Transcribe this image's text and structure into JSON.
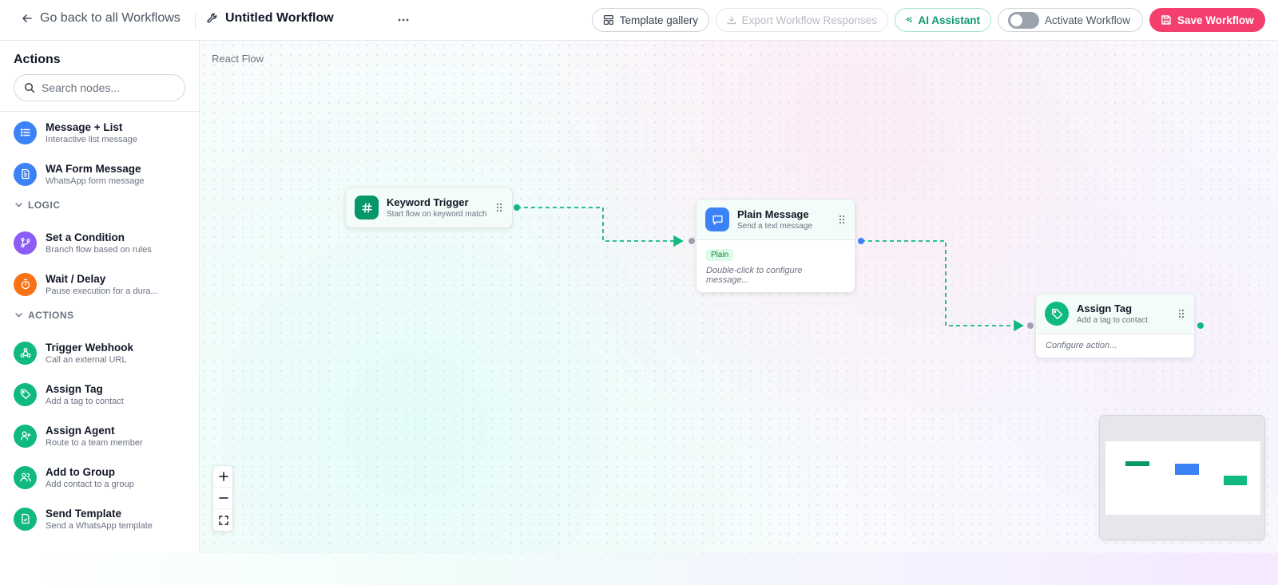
{
  "header": {
    "back_label": "Go back to all Workflows",
    "title": "Untitled Workflow",
    "buttons": {
      "template_gallery": "Template gallery",
      "export": "Export Workflow Responses",
      "ai_assistant": "AI Assistant",
      "activate": "Activate Workflow",
      "save": "Save Workflow"
    }
  },
  "sidebar": {
    "title": "Actions",
    "search_placeholder": "Search nodes...",
    "items_top": [
      {
        "name": "Message + List",
        "desc": "Interactive list message",
        "icon": "list-icon"
      },
      {
        "name": "WA Form Message",
        "desc": "WhatsApp form message",
        "icon": "form-icon"
      }
    ],
    "sections": [
      {
        "label": "LOGIC",
        "items": [
          {
            "name": "Set a Condition",
            "desc": "Branch flow based on rules",
            "icon": "branch-icon"
          },
          {
            "name": "Wait / Delay",
            "desc": "Pause execution for a dura...",
            "icon": "timer-icon"
          }
        ]
      },
      {
        "label": "ACTIONS",
        "items": [
          {
            "name": "Trigger Webhook",
            "desc": "Call an external URL",
            "icon": "webhook-icon"
          },
          {
            "name": "Assign Tag",
            "desc": "Add a tag to contact",
            "icon": "tag-icon"
          },
          {
            "name": "Assign Agent",
            "desc": "Route to a team member",
            "icon": "user-plus-icon"
          },
          {
            "name": "Add to Group",
            "desc": "Add contact to a group",
            "icon": "users-icon"
          },
          {
            "name": "Send Template",
            "desc": "Send a WhatsApp template",
            "icon": "template-icon"
          }
        ]
      }
    ]
  },
  "canvas": {
    "label": "React Flow",
    "nodes": {
      "keyword": {
        "name": "Keyword Trigger",
        "desc": "Start flow on keyword match",
        "icon": "hash-icon"
      },
      "plain": {
        "name": "Plain Message",
        "desc": "Send a text message",
        "pill": "Plain",
        "hint": "Double-click to configure message...",
        "icon": "message-icon"
      },
      "tag": {
        "name": "Assign Tag",
        "desc": "Add a tag to contact",
        "hint": "Configure action...",
        "icon": "tag-icon"
      }
    }
  },
  "colors": {
    "accent_green": "#10b981",
    "dark_green": "#059669",
    "blue": "#3b82f6",
    "purple": "#8b5cf6",
    "orange": "#f97316",
    "save_pink": "#f43f6e"
  }
}
